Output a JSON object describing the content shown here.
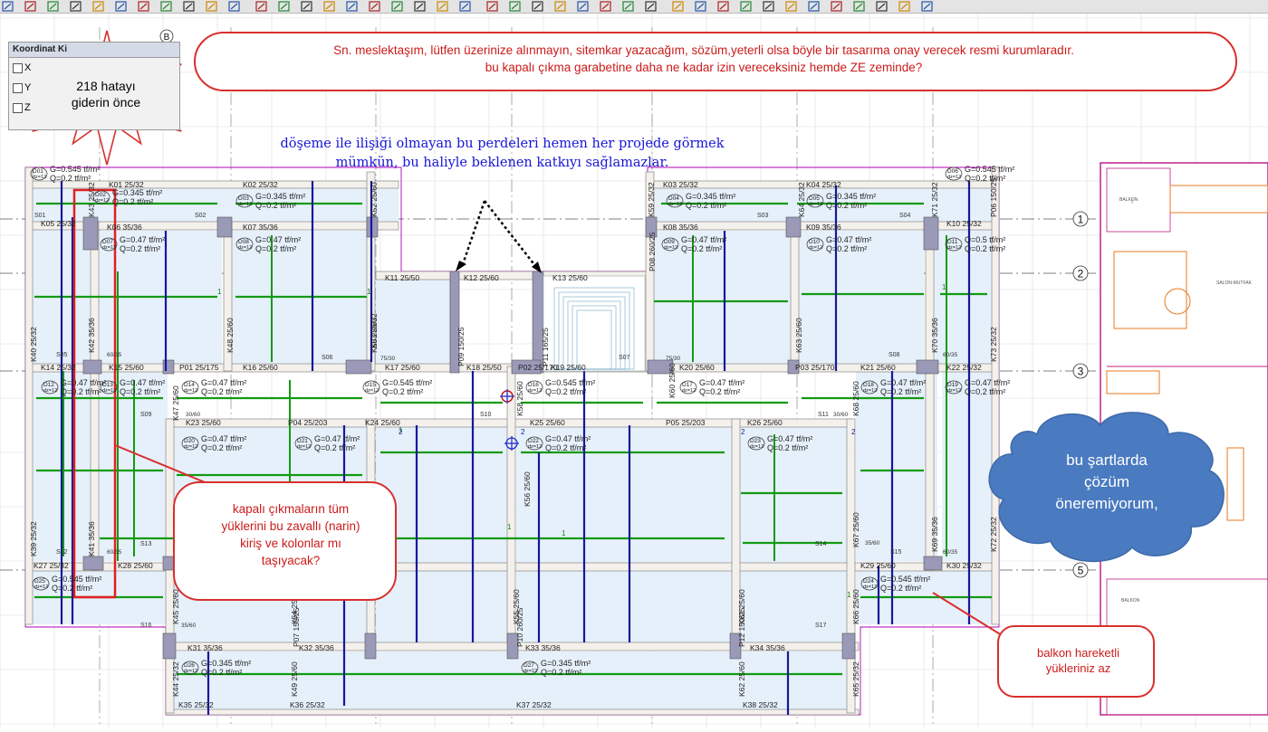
{
  "toolbar": {
    "icons": [
      "select-icon",
      "snap-icon",
      "trim-icon",
      "move-icon",
      "rotate-icon",
      "line-icon",
      "frame-icon",
      "column-icon",
      "beam-icon",
      "wall-icon",
      "slab-icon",
      "image-icon",
      "curve-icon",
      "polyline-icon",
      "circle-icon",
      "hatch-icon",
      "dimension-icon",
      "grid-icon",
      "table-icon",
      "elevation-icon",
      "axis-icon",
      "copy-icon",
      "mirror-icon",
      "flip-icon",
      "scale-icon",
      "report-icon",
      "report2-icon",
      "report3-icon",
      "zoom-icon",
      "pin-icon",
      "pen-icon",
      "triangle-icon",
      "marker-icon",
      "paint-icon",
      "fill-icon",
      "chart-icon",
      "vector-icon",
      "arrow-icon",
      "sketch-icon",
      "flag-icon",
      "window-icon"
    ]
  },
  "coord_panel": {
    "title": "Koordinat Ki",
    "rows": [
      "X",
      "Y",
      "Z"
    ]
  },
  "annotations": {
    "top_line1": "Sn. meslektaşım, lütfen üzerinize alınmayın, sitemkar yazacağım,  sözüm,yeterli olsa böyle bir tasarıma onay verecek resmi kurumlaradır.",
    "top_line2": "bu  kapalı çıkma garabetine daha ne kadar izin vereceksiniz hemde ZE zeminde?",
    "star_line1": "218 hatayı",
    "star_line2": "giderin önce",
    "blue_line1": "döşeme ile ilişiği olmayan bu perdeleri hemen her projede görmek",
    "blue_line2": "mümkün, bu haliyle beklenen katkıyı sağlamazlar.",
    "left_line1": "kapalı çıkmaların tüm",
    "left_line2": "yüklerini bu zavallı (narin)",
    "left_line3": "kiriş ve kolonlar mı",
    "left_line4": "taşıyacak?",
    "cloud_line1": "bu şartlarda",
    "cloud_line2": "çözüm",
    "cloud_line3": "öneremiyorum,",
    "bottom_line1": "balkon hareketli",
    "bottom_line2": "yükleriniz az"
  },
  "plan": {
    "axis_numbers": [
      "1",
      "2",
      "3",
      "4",
      "5"
    ],
    "axis_letter": "B",
    "beams": [
      "K01 25/32",
      "K02 25/32",
      "K03 25/32",
      "K04 25/32",
      "K05 25/32",
      "K06 35/36",
      "K07 35/36",
      "K08 35/36",
      "K09 35/36",
      "K10 25/32",
      "K11 25/50",
      "K12 25/60",
      "K13 25/60",
      "K14 25/32",
      "K15 25/60",
      "P01 25/175",
      "K16 25/60",
      "K17 25/60",
      "K18 25/50",
      "P02 25/170",
      "K19 25/60",
      "K20 25/60",
      "P03 25/170",
      "K21 25/60",
      "K22 25/32",
      "K23 25/60",
      "P04 25/203",
      "K24 25/60",
      "K25 25/60",
      "P05 25/203",
      "K26 25/60",
      "K27 25/32",
      "K28 25/60",
      "K29 25/60",
      "K30 25/32",
      "K31 35/36",
      "K32 35/36",
      "K33 35/36",
      "K34 35/36",
      "K35 25/32",
      "K36 25/32",
      "K37 25/32",
      "K38 25/32"
    ],
    "vertical_beams": [
      "K39 25/32",
      "K40 25/32",
      "K41 35/36",
      "K42 35/36",
      "K43 25/32",
      "K44 25/32",
      "K45 25/60",
      "K47 25/60",
      "K48 25/60",
      "K49 25/60",
      "K50 25/60",
      "K52 25/60",
      "K53 25/32",
      "K54 25/60",
      "K55 25/60",
      "K56 25/60",
      "K58 25/60",
      "K59 25/32",
      "K60 25/60",
      "K61 25/60",
      "K62 25/60",
      "K63 25/60",
      "K64 25/32",
      "K65 25/32",
      "K66 25/60",
      "K67 25/60",
      "K68 25/60",
      "K69 35/36",
      "K70 35/36",
      "K71 25/32",
      "K72 25/32",
      "K73 25/32",
      "P06 150/25",
      "P07 150/25",
      "P08 260/25",
      "P09 150/25",
      "P10 260/25",
      "P11 165/25",
      "P12 150/25"
    ],
    "slab_loads": {
      "load_a": "G=0.545 tf/m²",
      "load_b": "G=0.345 tf/m²",
      "load_c": "G=0.47 tf/m²",
      "load_d": "Q=0.2 tf/m²",
      "load_e": "Q=0.5 tf/m²"
    },
    "slabs": [
      "D01",
      "D02",
      "D03",
      "D04",
      "D05",
      "D06",
      "D07",
      "D08",
      "D09",
      "D10",
      "D11",
      "D12",
      "D13",
      "D14",
      "D15",
      "D16",
      "D17",
      "D18",
      "D19",
      "D20",
      "D21",
      "D22",
      "D23",
      "D24",
      "D25",
      "D26",
      "D27"
    ],
    "spaces": [
      "S01",
      "S02",
      "S03",
      "S04",
      "S05",
      "S06",
      "S07",
      "S08",
      "S09",
      "S10",
      "S11",
      "S12",
      "S13",
      "S14",
      "S15",
      "S16",
      "S17"
    ],
    "misc_labels": [
      "60/35",
      "75/30",
      "30/60",
      "35/60",
      "1",
      "2",
      "dz=12"
    ],
    "room_labels": [
      "BALKON",
      "SALON-MUTFAK",
      "BALKON"
    ]
  }
}
